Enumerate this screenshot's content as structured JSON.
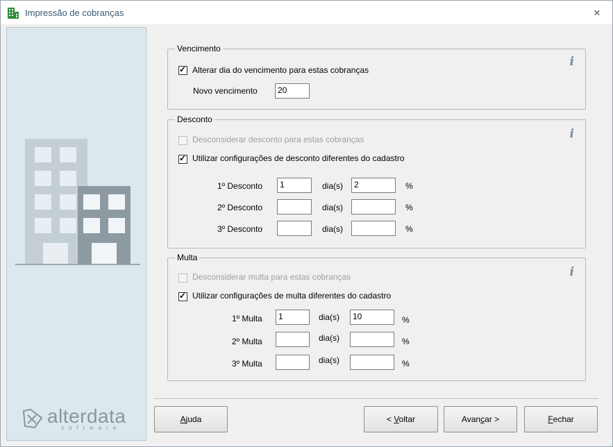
{
  "window": {
    "title": "Impressão de cobranças"
  },
  "icons": {
    "title_icon": "building-icon",
    "close_icon": "close-icon",
    "info_icon": "info-icon"
  },
  "brand": {
    "name": "alterdata",
    "sub": "software"
  },
  "vencimento": {
    "label": "Vencimento",
    "alterar_label": "Alterar dia do vencimento para estas cobranças",
    "alterar_checked": true,
    "novo_label": "Novo vencimento",
    "novo_value": "20"
  },
  "desconto": {
    "label": "Desconto",
    "desconsiderar_label": "Desconsiderar desconto para estas cobranças",
    "desconsiderar_checked": false,
    "utilizar_label": "Utilizar configurações de desconto diferentes do cadastro",
    "utilizar_checked": true,
    "rows": [
      {
        "label": "1º Desconto",
        "dias": "1",
        "dias_label": "dia(s)",
        "pct": "2",
        "pct_label": "%"
      },
      {
        "label": "2º Desconto",
        "dias": "",
        "dias_label": "dia(s)",
        "pct": "",
        "pct_label": "%"
      },
      {
        "label": "3º Desconto",
        "dias": "",
        "dias_label": "dia(s)",
        "pct": "",
        "pct_label": "%"
      }
    ]
  },
  "multa": {
    "label": "Multa",
    "desconsiderar_label": "Desconsiderar multa para estas cobranças",
    "desconsiderar_checked": false,
    "utilizar_label": "Utilizar configurações de multa diferentes do cadastro",
    "utilizar_checked": true,
    "rows": [
      {
        "label": "1º Multa",
        "dias": "1",
        "dias_label": "dia(s)",
        "pct": "10",
        "pct_label": "%"
      },
      {
        "label": "2º Multa",
        "dias": "",
        "dias_label": "dia(s)",
        "pct": "",
        "pct_label": "%"
      },
      {
        "label": "3º Multa",
        "dias": "",
        "dias_label": "dia(s)",
        "pct": "",
        "pct_label": "%"
      }
    ]
  },
  "buttons": {
    "ajuda": {
      "pre": "",
      "mn": "A",
      "post": "juda"
    },
    "voltar": {
      "pre": "< ",
      "mn": "V",
      "post": "oltar"
    },
    "avancar": {
      "pre": "Avan",
      "mn": "ç",
      "post": "ar >"
    },
    "fechar": {
      "pre": "",
      "mn": "F",
      "post": "echar"
    }
  }
}
